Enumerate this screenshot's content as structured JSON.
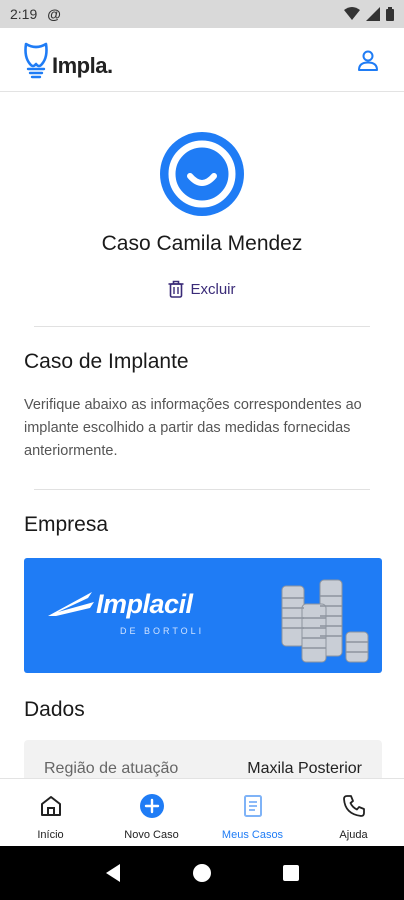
{
  "status_bar": {
    "time": "2:19"
  },
  "header": {
    "logo_text": "Impla."
  },
  "case": {
    "title": "Caso Camila Mendez",
    "delete_label": "Excluir"
  },
  "implant_section": {
    "title": "Caso de Implante",
    "description": "Verifique abaixo as informações correspondentes ao implante escolhido a partir das medidas fornecidas anteriormente."
  },
  "company_section": {
    "title": "Empresa",
    "brand_name": "Implacil",
    "brand_subtitle": "DE BORTOLI"
  },
  "data_section": {
    "title": "Dados",
    "rows": [
      {
        "label": "Região de atuação",
        "value": "Maxila Posterior"
      }
    ]
  },
  "bottom_nav": {
    "items": [
      {
        "label": "Início",
        "icon": "home-icon"
      },
      {
        "label": "Novo Caso",
        "icon": "add-circle-icon"
      },
      {
        "label": "Meus Casos",
        "icon": "book-icon",
        "active": true
      },
      {
        "label": "Ajuda",
        "icon": "phone-icon"
      }
    ]
  },
  "colors": {
    "accent": "#1f7cf5",
    "delete": "#3a2b78"
  }
}
